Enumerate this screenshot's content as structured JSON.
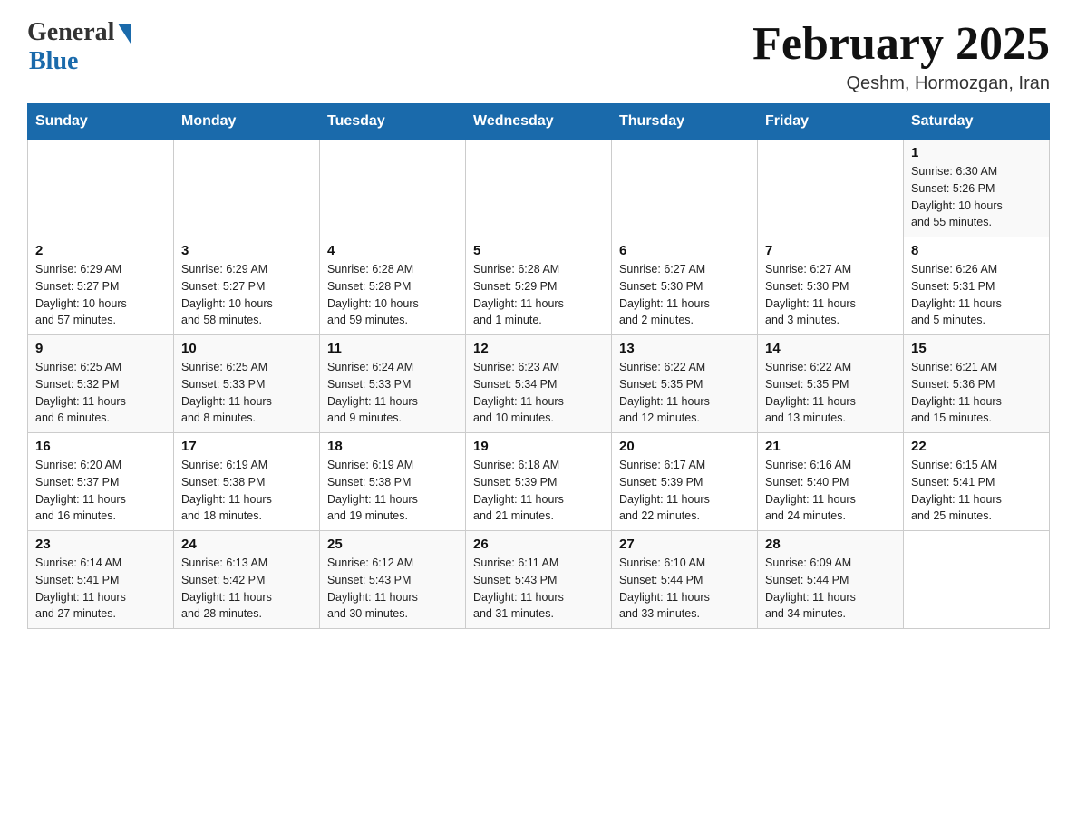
{
  "header": {
    "logo_general": "General",
    "logo_blue": "Blue",
    "month_title": "February 2025",
    "subtitle": "Qeshm, Hormozgan, Iran"
  },
  "weekdays": [
    "Sunday",
    "Monday",
    "Tuesday",
    "Wednesday",
    "Thursday",
    "Friday",
    "Saturday"
  ],
  "weeks": [
    {
      "days": [
        {
          "num": "",
          "info": ""
        },
        {
          "num": "",
          "info": ""
        },
        {
          "num": "",
          "info": ""
        },
        {
          "num": "",
          "info": ""
        },
        {
          "num": "",
          "info": ""
        },
        {
          "num": "",
          "info": ""
        },
        {
          "num": "1",
          "info": "Sunrise: 6:30 AM\nSunset: 5:26 PM\nDaylight: 10 hours\nand 55 minutes."
        }
      ]
    },
    {
      "days": [
        {
          "num": "2",
          "info": "Sunrise: 6:29 AM\nSunset: 5:27 PM\nDaylight: 10 hours\nand 57 minutes."
        },
        {
          "num": "3",
          "info": "Sunrise: 6:29 AM\nSunset: 5:27 PM\nDaylight: 10 hours\nand 58 minutes."
        },
        {
          "num": "4",
          "info": "Sunrise: 6:28 AM\nSunset: 5:28 PM\nDaylight: 10 hours\nand 59 minutes."
        },
        {
          "num": "5",
          "info": "Sunrise: 6:28 AM\nSunset: 5:29 PM\nDaylight: 11 hours\nand 1 minute."
        },
        {
          "num": "6",
          "info": "Sunrise: 6:27 AM\nSunset: 5:30 PM\nDaylight: 11 hours\nand 2 minutes."
        },
        {
          "num": "7",
          "info": "Sunrise: 6:27 AM\nSunset: 5:30 PM\nDaylight: 11 hours\nand 3 minutes."
        },
        {
          "num": "8",
          "info": "Sunrise: 6:26 AM\nSunset: 5:31 PM\nDaylight: 11 hours\nand 5 minutes."
        }
      ]
    },
    {
      "days": [
        {
          "num": "9",
          "info": "Sunrise: 6:25 AM\nSunset: 5:32 PM\nDaylight: 11 hours\nand 6 minutes."
        },
        {
          "num": "10",
          "info": "Sunrise: 6:25 AM\nSunset: 5:33 PM\nDaylight: 11 hours\nand 8 minutes."
        },
        {
          "num": "11",
          "info": "Sunrise: 6:24 AM\nSunset: 5:33 PM\nDaylight: 11 hours\nand 9 minutes."
        },
        {
          "num": "12",
          "info": "Sunrise: 6:23 AM\nSunset: 5:34 PM\nDaylight: 11 hours\nand 10 minutes."
        },
        {
          "num": "13",
          "info": "Sunrise: 6:22 AM\nSunset: 5:35 PM\nDaylight: 11 hours\nand 12 minutes."
        },
        {
          "num": "14",
          "info": "Sunrise: 6:22 AM\nSunset: 5:35 PM\nDaylight: 11 hours\nand 13 minutes."
        },
        {
          "num": "15",
          "info": "Sunrise: 6:21 AM\nSunset: 5:36 PM\nDaylight: 11 hours\nand 15 minutes."
        }
      ]
    },
    {
      "days": [
        {
          "num": "16",
          "info": "Sunrise: 6:20 AM\nSunset: 5:37 PM\nDaylight: 11 hours\nand 16 minutes."
        },
        {
          "num": "17",
          "info": "Sunrise: 6:19 AM\nSunset: 5:38 PM\nDaylight: 11 hours\nand 18 minutes."
        },
        {
          "num": "18",
          "info": "Sunrise: 6:19 AM\nSunset: 5:38 PM\nDaylight: 11 hours\nand 19 minutes."
        },
        {
          "num": "19",
          "info": "Sunrise: 6:18 AM\nSunset: 5:39 PM\nDaylight: 11 hours\nand 21 minutes."
        },
        {
          "num": "20",
          "info": "Sunrise: 6:17 AM\nSunset: 5:39 PM\nDaylight: 11 hours\nand 22 minutes."
        },
        {
          "num": "21",
          "info": "Sunrise: 6:16 AM\nSunset: 5:40 PM\nDaylight: 11 hours\nand 24 minutes."
        },
        {
          "num": "22",
          "info": "Sunrise: 6:15 AM\nSunset: 5:41 PM\nDaylight: 11 hours\nand 25 minutes."
        }
      ]
    },
    {
      "days": [
        {
          "num": "23",
          "info": "Sunrise: 6:14 AM\nSunset: 5:41 PM\nDaylight: 11 hours\nand 27 minutes."
        },
        {
          "num": "24",
          "info": "Sunrise: 6:13 AM\nSunset: 5:42 PM\nDaylight: 11 hours\nand 28 minutes."
        },
        {
          "num": "25",
          "info": "Sunrise: 6:12 AM\nSunset: 5:43 PM\nDaylight: 11 hours\nand 30 minutes."
        },
        {
          "num": "26",
          "info": "Sunrise: 6:11 AM\nSunset: 5:43 PM\nDaylight: 11 hours\nand 31 minutes."
        },
        {
          "num": "27",
          "info": "Sunrise: 6:10 AM\nSunset: 5:44 PM\nDaylight: 11 hours\nand 33 minutes."
        },
        {
          "num": "28",
          "info": "Sunrise: 6:09 AM\nSunset: 5:44 PM\nDaylight: 11 hours\nand 34 minutes."
        },
        {
          "num": "",
          "info": ""
        }
      ]
    }
  ]
}
